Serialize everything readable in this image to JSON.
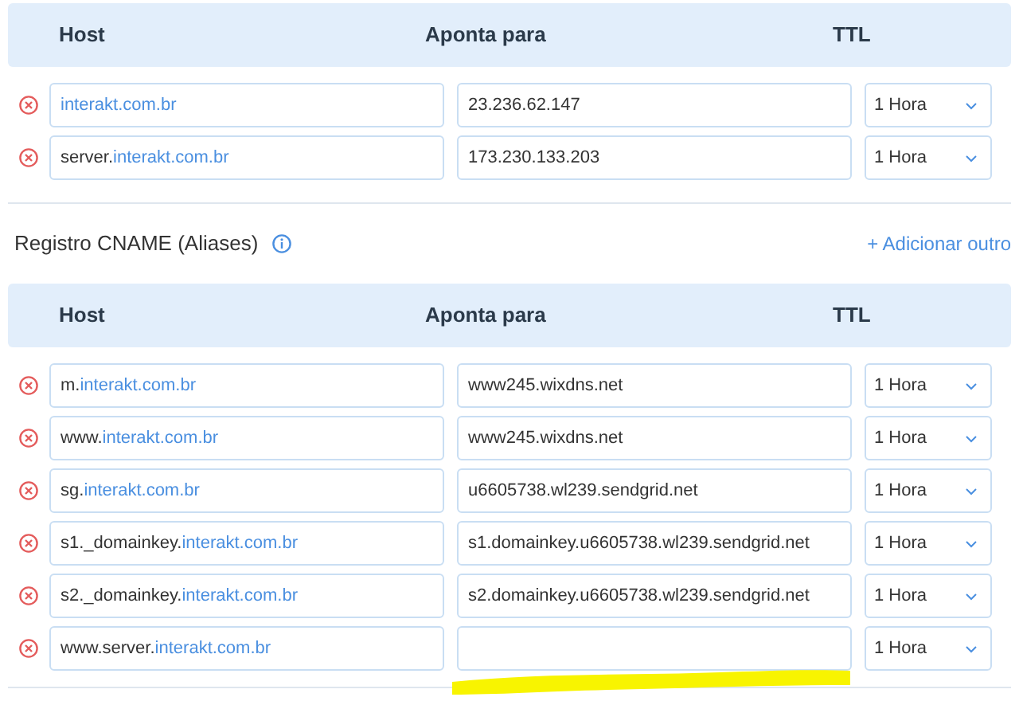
{
  "a_records": {
    "columns": [
      "Host",
      "Aponta para",
      "TTL"
    ],
    "rows": [
      {
        "host_prefix": "",
        "host_domain": "interakt.com.br",
        "value": "23.236.62.147",
        "ttl": "1 Hora"
      },
      {
        "host_prefix": "server.",
        "host_domain": "interakt.com.br",
        "value": "173.230.133.203",
        "ttl": "1 Hora"
      }
    ]
  },
  "cname_section": {
    "title": "Registro CNAME (Aliases)",
    "add_link": "+ Adicionar outro",
    "columns": [
      "Host",
      "Aponta para",
      "TTL"
    ],
    "rows": [
      {
        "host_prefix": "m.",
        "host_domain": "interakt.com.br",
        "value": "www245.wixdns.net",
        "ttl": "1 Hora"
      },
      {
        "host_prefix": "www.",
        "host_domain": "interakt.com.br",
        "value": "www245.wixdns.net",
        "ttl": "1 Hora"
      },
      {
        "host_prefix": "sg.",
        "host_domain": "interakt.com.br",
        "value": "u6605738.wl239.sendgrid.net",
        "ttl": "1 Hora"
      },
      {
        "host_prefix": "s1._domainkey.",
        "host_domain": "interakt.com.br",
        "value": "s1.domainkey.u6605738.wl239.sendgrid.net",
        "ttl": "1 Hora"
      },
      {
        "host_prefix": "s2._domainkey.",
        "host_domain": "interakt.com.br",
        "value": "s2.domainkey.u6605738.wl239.sendgrid.net",
        "ttl": "1 Hora"
      },
      {
        "host_prefix": "www.server.",
        "host_domain": "interakt.com.br",
        "ttl": "1 Hora"
      }
    ]
  }
}
